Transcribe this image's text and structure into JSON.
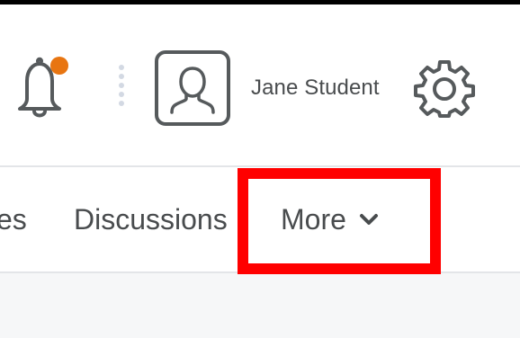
{
  "header": {
    "user": {
      "name": "Jane Student"
    },
    "notifications": {
      "icon": "bell-icon",
      "has_unread": true,
      "badge_color": "#e87511"
    },
    "settings": {
      "icon": "gear-icon"
    }
  },
  "navbar": {
    "items": [
      {
        "label": "es"
      },
      {
        "label": "Discussions"
      },
      {
        "label": "More",
        "icon": "chevron-down-icon"
      }
    ]
  },
  "annotation": {
    "highlight_color": "#ff0000",
    "target": "More"
  }
}
